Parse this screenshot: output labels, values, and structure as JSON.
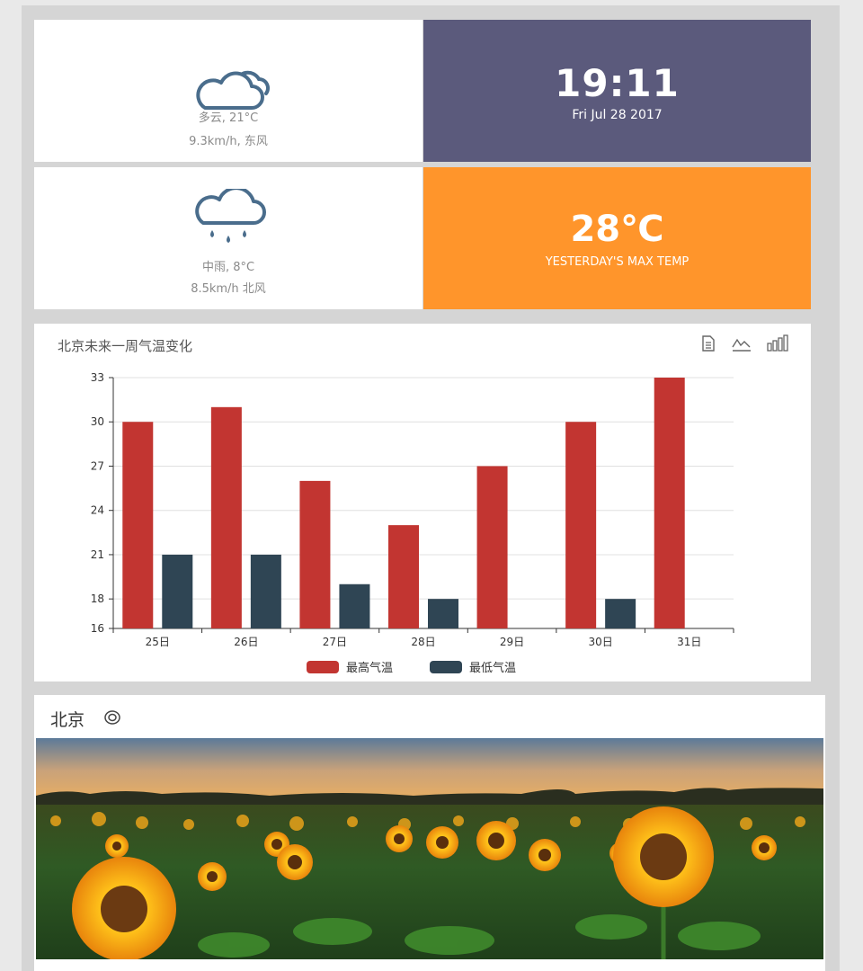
{
  "weather_today": {
    "icon": "cloudy-icon",
    "desc": "多云, 21°C",
    "wind": "9.3km/h, 东风"
  },
  "clock": {
    "time": "19:11",
    "date": "Fri Jul 28 2017"
  },
  "weather_tomorrow": {
    "icon": "rain-icon",
    "desc": "中雨, 8°C",
    "wind": "8.5km/h 北风"
  },
  "yesterday": {
    "temp": "28℃",
    "caption": "YESTERDAY'S MAX TEMP"
  },
  "colors": {
    "clock_bg": "#5b5a7c",
    "temp_bg": "#ff952b",
    "max_series": "#c23531",
    "min_series": "#2f4554",
    "weather_icon": "#4a6d8c"
  },
  "toolbox": {
    "icons": [
      "data-view-icon",
      "line-chart-icon",
      "bar-chart-icon"
    ]
  },
  "chart_data": {
    "type": "bar",
    "title": "北京未来一周气温变化",
    "categories": [
      "25日",
      "26日",
      "27日",
      "28日",
      "29日",
      "30日",
      "31日"
    ],
    "series": [
      {
        "name": "最高气温",
        "values": [
          30,
          31,
          26,
          23,
          27,
          30,
          33
        ]
      },
      {
        "name": "最低气温",
        "values": [
          21,
          21,
          19,
          18,
          null,
          18,
          null
        ]
      }
    ],
    "ylim": [
      16,
      33
    ],
    "yticks": [
      16,
      18,
      21,
      24,
      27,
      30,
      33
    ],
    "grid": true,
    "legend_position": "bottom"
  },
  "photo_card": {
    "title": "北京",
    "pin_icon": "location-pin-icon",
    "image": "sunflower-field-photo"
  }
}
